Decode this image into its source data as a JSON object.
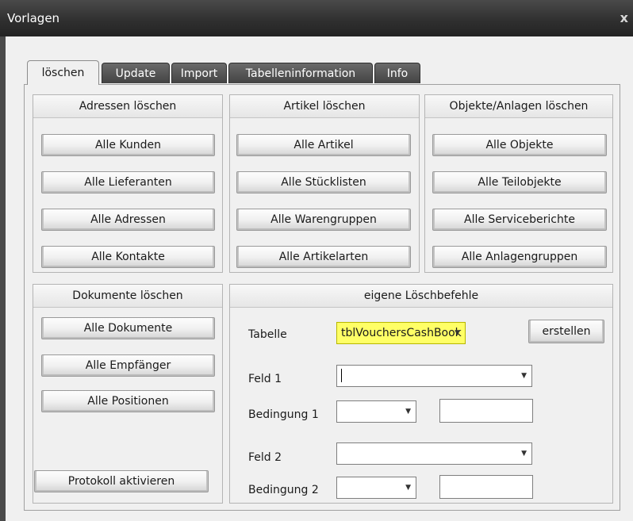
{
  "window": {
    "title": "Vorlagen",
    "close_label": "x"
  },
  "tabs": [
    {
      "label": "löschen",
      "active": true
    },
    {
      "label": "Update",
      "active": false
    },
    {
      "label": "Import",
      "active": false
    },
    {
      "label": "Tabelleninformation",
      "active": false
    },
    {
      "label": "Info",
      "active": false
    }
  ],
  "adressen": {
    "header": "Adressen löschen",
    "buttons": [
      "Alle Kunden",
      "Alle Lieferanten",
      "Alle Adressen",
      "Alle Kontakte"
    ]
  },
  "artikel": {
    "header": "Artikel löschen",
    "buttons": [
      "Alle Artikel",
      "Alle Stücklisten",
      "Alle Warengruppen",
      "Alle Artikelarten"
    ]
  },
  "objekte": {
    "header": "Objekte/Anlagen löschen",
    "buttons": [
      "Alle Objekte",
      "Alle Teilobjekte",
      "Alle Serviceberichte",
      "Alle Anlagengruppen"
    ]
  },
  "dokumente": {
    "header": "Dokumente löschen",
    "buttons": [
      "Alle Dokumente",
      "Alle Empfänger",
      "Alle Positionen"
    ],
    "protokoll_label": "Protokoll aktivieren"
  },
  "eigene": {
    "header": "eigene Löschbefehle",
    "tabelle_label": "Tabelle",
    "tabelle_value": "tblVouchersCashBook",
    "erstellen_label": "erstellen",
    "feld1_label": "Feld 1",
    "bedingung1_label": "Bedingung 1",
    "feld2_label": "Feld 2",
    "bedingung2_label": "Bedingung 2",
    "feld1_value": "",
    "bedingung1_value": "",
    "wert1_value": "",
    "feld2_value": "",
    "bedingung2_value": "",
    "wert2_value": ""
  },
  "colors": {
    "titlebar": "#303030",
    "highlight_combo": "#ffff66",
    "client_bg": "#f0f0f0"
  }
}
